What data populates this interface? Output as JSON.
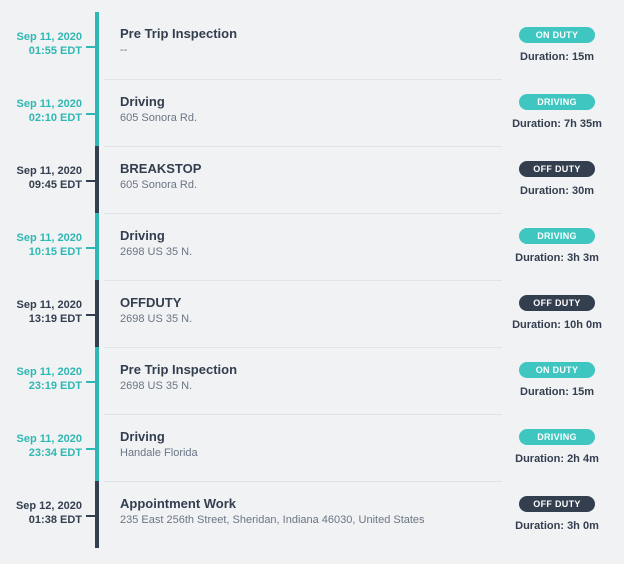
{
  "events": [
    {
      "date": "Sep 11, 2020",
      "time": "01:55 EDT",
      "title": "Pre Trip Inspection",
      "sub": "--",
      "status_label": "ON DUTY",
      "status_class": "on-duty",
      "duration": "Duration: 15m",
      "color": "teal"
    },
    {
      "date": "Sep 11, 2020",
      "time": "02:10 EDT",
      "title": "Driving",
      "sub": "605 Sonora Rd.",
      "status_label": "DRIVING",
      "status_class": "driving",
      "duration": "Duration: 7h 35m",
      "color": "teal"
    },
    {
      "date": "Sep 11, 2020",
      "time": "09:45 EDT",
      "title": "BREAKSTOP",
      "sub": "605 Sonora Rd.",
      "status_label": "OFF DUTY",
      "status_class": "off-duty",
      "duration": "Duration: 30m",
      "color": "dark"
    },
    {
      "date": "Sep 11, 2020",
      "time": "10:15 EDT",
      "title": "Driving",
      "sub": "2698 US 35 N.",
      "status_label": "DRIVING",
      "status_class": "driving",
      "duration": "Duration: 3h 3m",
      "color": "teal"
    },
    {
      "date": "Sep 11, 2020",
      "time": "13:19 EDT",
      "title": "OFFDUTY",
      "sub": "2698 US 35 N.",
      "status_label": "OFF DUTY",
      "status_class": "off-duty",
      "duration": "Duration: 10h 0m",
      "color": "dark"
    },
    {
      "date": "Sep 11, 2020",
      "time": "23:19 EDT",
      "title": "Pre Trip Inspection",
      "sub": "2698 US 35 N.",
      "status_label": "ON DUTY",
      "status_class": "on-duty",
      "duration": "Duration: 15m",
      "color": "teal"
    },
    {
      "date": "Sep 11, 2020",
      "time": "23:34 EDT",
      "title": "Driving",
      "sub": "Handale Florida",
      "status_label": "DRIVING",
      "status_class": "driving",
      "duration": "Duration: 2h 4m",
      "color": "teal"
    },
    {
      "date": "Sep 12, 2020",
      "time": "01:38 EDT",
      "title": "Appointment Work",
      "sub": "235 East 256th Street, Sheridan, Indiana 46030, United States",
      "status_label": "OFF DUTY",
      "status_class": "off-duty",
      "duration": "Duration: 3h 0m",
      "color": "dark"
    }
  ]
}
